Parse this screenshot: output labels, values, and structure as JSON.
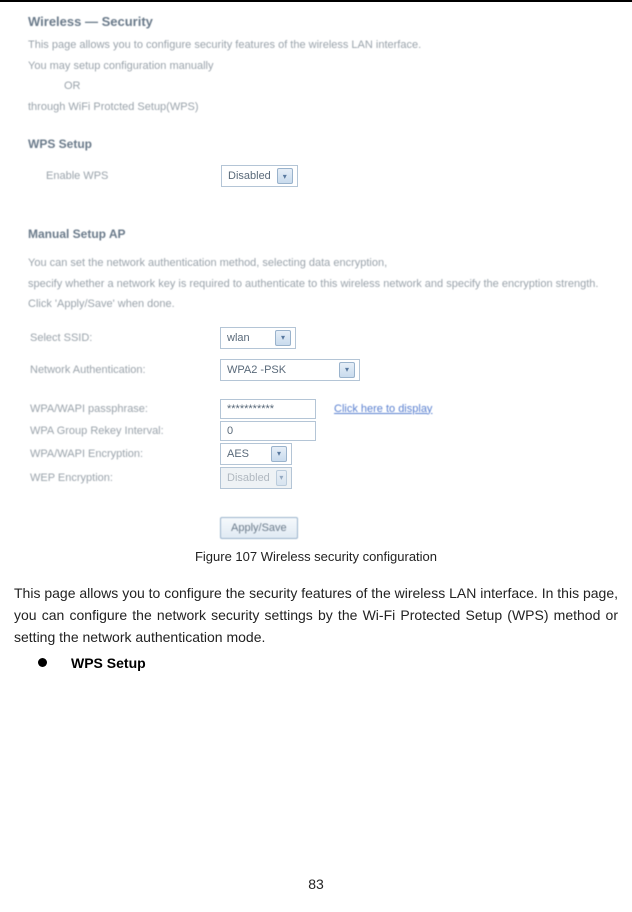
{
  "screenshot": {
    "heading": "Wireless — Security",
    "desc_line1": "This page allows you to configure security features of the wireless LAN interface.",
    "desc_line2": "You may setup configuration manually",
    "desc_line3": "OR",
    "desc_line4": "through WiFi Protcted Setup(WPS)",
    "wps": {
      "section": "WPS Setup",
      "enable_label": "Enable WPS",
      "enable_value": "Disabled"
    },
    "manual": {
      "section": "Manual Setup AP",
      "desc1": "You can set the network authentication method, selecting data encryption,",
      "desc2": "specify whether a network key is required to authenticate to this wireless network and specify the encryption strength.",
      "desc3": "Click 'Apply/Save' when done.",
      "ssid_label": "Select SSID:",
      "ssid_value": "wlan",
      "auth_label": "Network Authentication:",
      "auth_value": "WPA2 -PSK",
      "pass_label": "WPA/WAPI passphrase:",
      "pass_value": "***********",
      "display_link": "Click here to display",
      "rekey_label": "WPA Group Rekey Interval:",
      "rekey_value": "0",
      "enc_label": "WPA/WAPI Encryption:",
      "enc_value": "AES",
      "wep_label": "WEP Encryption:",
      "wep_value": "Disabled",
      "apply": "Apply/Save"
    }
  },
  "caption": "Figure 107 Wireless security configuration",
  "body": "This page allows you to configure the security features of the wireless LAN interface. In this page, you can configure the network security settings by the Wi-Fi Protected Setup (WPS) method or setting the network authentication mode.",
  "bullet": "WPS Setup",
  "page_number": "83"
}
